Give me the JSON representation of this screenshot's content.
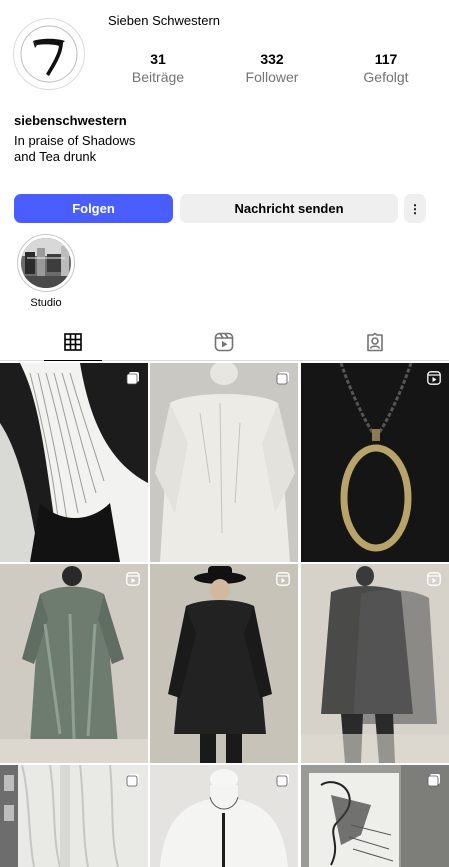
{
  "profile": {
    "display_name": "Sieben Schwestern",
    "username": "siebenschwestern",
    "bio_lines": [
      "In praise of Shadows",
      "and Tea drunk"
    ],
    "stats": {
      "posts": {
        "value": "31",
        "label": "Beiträge"
      },
      "followers": {
        "value": "332",
        "label": "Follower"
      },
      "following": {
        "value": "117",
        "label": "Gefolgt"
      }
    }
  },
  "actions": {
    "follow_label": "Folgen",
    "message_label": "Nachricht senden",
    "more_label": "⋮"
  },
  "highlights": [
    {
      "label": "Studio"
    }
  ],
  "tabs": [
    {
      "icon": "grid-icon",
      "active": true
    },
    {
      "icon": "reels-icon",
      "active": false
    },
    {
      "icon": "tagged-icon",
      "active": false
    }
  ],
  "posts": [
    {
      "type": "carousel",
      "subject": "silver chain necklaces on white bust"
    },
    {
      "type": "carousel",
      "subject": "white sheer linen top on mannequin"
    },
    {
      "type": "reel",
      "subject": "chain necklace with brass oval clasp"
    },
    {
      "type": "reel",
      "subject": "grey-green printed long dress"
    },
    {
      "type": "reel",
      "subject": "woman in black hat and black coat"
    },
    {
      "type": "reel",
      "subject": "layered dark grey outfits"
    },
    {
      "type": "carousel",
      "subject": "white draped fabric by window"
    },
    {
      "type": "carousel",
      "subject": "white bust with pendant"
    },
    {
      "type": "carousel",
      "subject": "black and white illustration print"
    }
  ],
  "colors": {
    "follow_button": "#4a5dff",
    "secondary_button": "#efefef",
    "muted_text": "#737373"
  }
}
